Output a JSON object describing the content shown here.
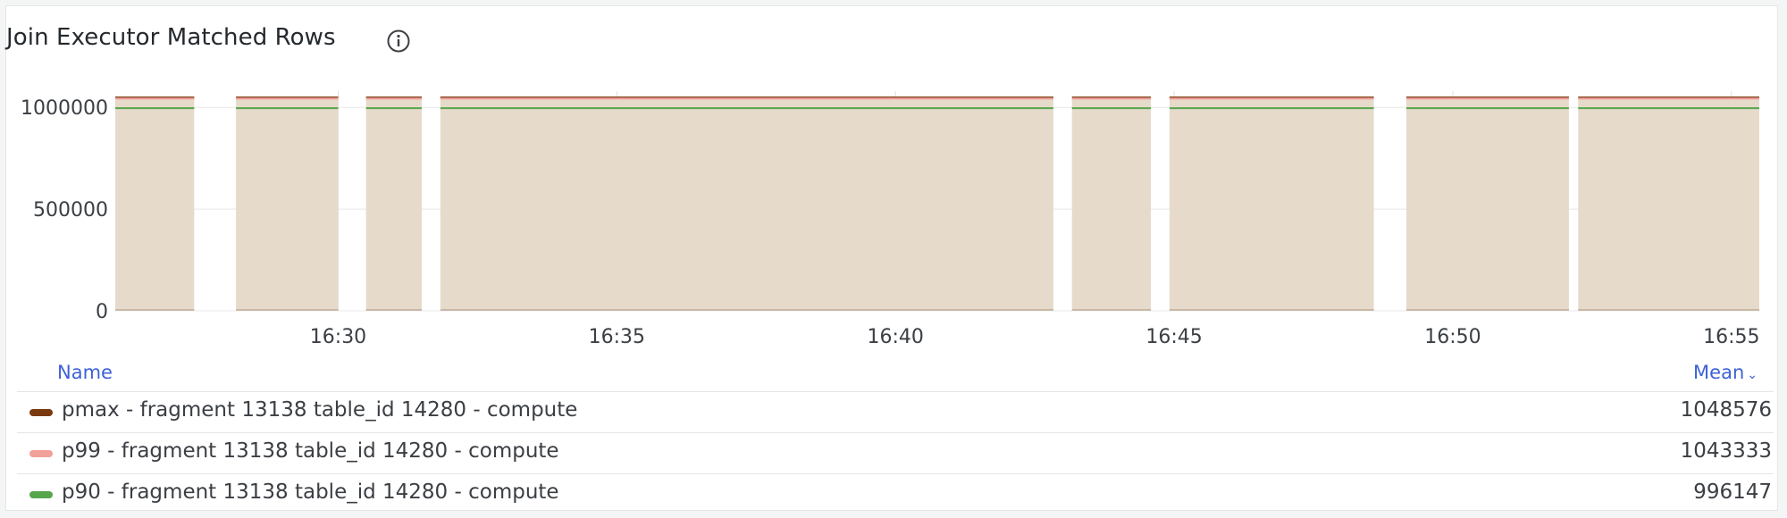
{
  "panel": {
    "title": "Join Executor Matched Rows"
  },
  "legend": {
    "name_header": "Name",
    "mean_header": "Mean"
  },
  "chart_data": {
    "type": "area",
    "title": "Join Executor Matched Rows",
    "ylim": [
      0,
      1080000
    ],
    "yticks": [
      0,
      500000,
      1000000
    ],
    "ytick_labels": [
      "0",
      "500000",
      "1000000"
    ],
    "xrange": [
      "16:26:00",
      "16:55:30"
    ],
    "xtick_labels": [
      "16:30",
      "16:35",
      "16:40",
      "16:45",
      "16:50",
      "16:55"
    ],
    "data_segments": [
      [
        "16:26:00",
        "16:27:25"
      ],
      [
        "16:28:10",
        "16:30:00"
      ],
      [
        "16:30:30",
        "16:31:30"
      ],
      [
        "16:31:50",
        "16:42:50"
      ],
      [
        "16:43:10",
        "16:44:35"
      ],
      [
        "16:44:55",
        "16:48:35"
      ],
      [
        "16:49:10",
        "16:52:05"
      ],
      [
        "16:52:15",
        "16:55:30"
      ]
    ],
    "series": [
      {
        "name": "pmax - fragment 13138 table_id 14280 - compute",
        "color": "#7a3a10",
        "value": 1048576,
        "mean": "1048576"
      },
      {
        "name": "p99 - fragment 13138 table_id 14280 - compute",
        "color": "#f2a09a",
        "value": 1043333,
        "mean": "1043333"
      },
      {
        "name": "p90 - fragment 13138 table_id 14280 - compute",
        "color": "#56a64b",
        "value": 996147,
        "mean": "996147"
      }
    ],
    "grid": true,
    "legend_placement": "bottom"
  }
}
